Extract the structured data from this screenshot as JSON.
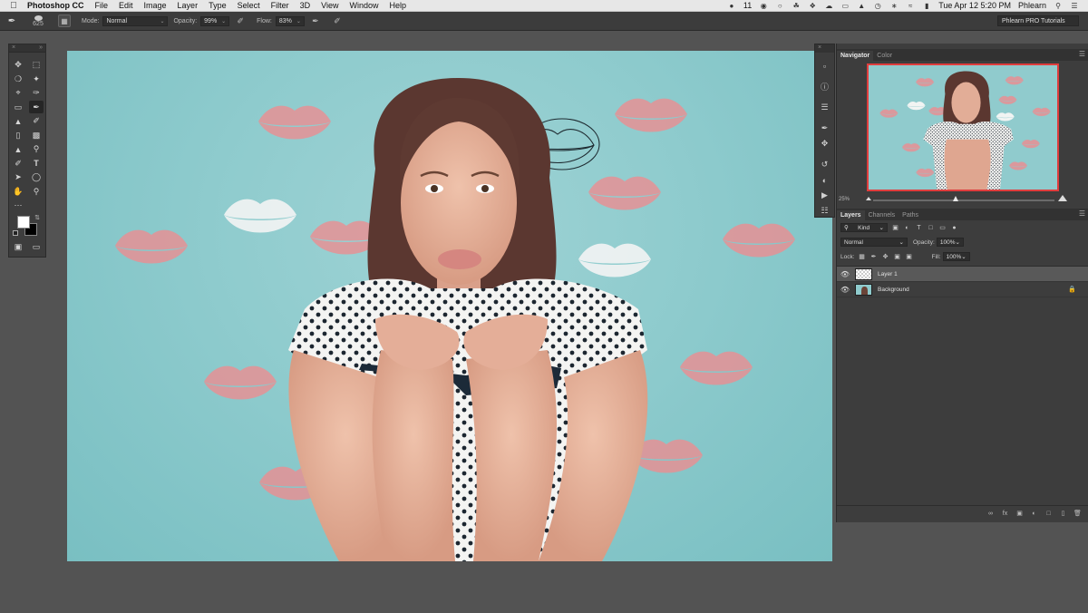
{
  "menubar": {
    "app_name": "Photoshop CC",
    "items": [
      "File",
      "Edit",
      "Image",
      "Layer",
      "Type",
      "Select",
      "Filter",
      "3D",
      "View",
      "Window",
      "Help"
    ],
    "notification_count": "11",
    "datetime": "Tue Apr 12  5:20 PM",
    "user": "Phlearn"
  },
  "options_bar": {
    "brush_size": "625",
    "mode_label": "Mode:",
    "mode_value": "Normal",
    "opacity_label": "Opacity:",
    "opacity_value": "99%",
    "flow_label": "Flow:",
    "flow_value": "83%",
    "workspace": "Phlearn PRO Tutorials"
  },
  "navigator": {
    "tabs": [
      "Navigator",
      "Color"
    ],
    "zoom": "25%"
  },
  "layers_panel": {
    "tabs": [
      "Layers",
      "Channels",
      "Paths"
    ],
    "filter_kind": "Kind",
    "blend_mode": "Normal",
    "opacity_label": "Opacity:",
    "opacity_value": "100%",
    "lock_label": "Lock:",
    "fill_label": "Fill:",
    "fill_value": "100%",
    "layers": [
      {
        "name": "Layer 1",
        "selected": true
      },
      {
        "name": "Background",
        "locked": true
      }
    ]
  },
  "colors": {
    "canvas_bg": "#8ecbcd",
    "kiss_pink": "#e98f93",
    "kiss_white": "#f1f4f3",
    "accent_red": "#e03d3d"
  },
  "icons": {
    "tools": [
      "move-icon",
      "marquee-icon",
      "lasso-icon",
      "magic-wand-icon",
      "crop-icon",
      "eyedropper-icon",
      "healing-icon",
      "brush-icon",
      "stamp-icon",
      "history-brush-icon",
      "eraser-icon",
      "gradient-icon",
      "blur-icon",
      "dodge-icon",
      "pen-icon",
      "type-icon",
      "path-select-icon",
      "shape-icon",
      "hand-icon",
      "zoom-icon",
      "more-tools-icon"
    ]
  }
}
